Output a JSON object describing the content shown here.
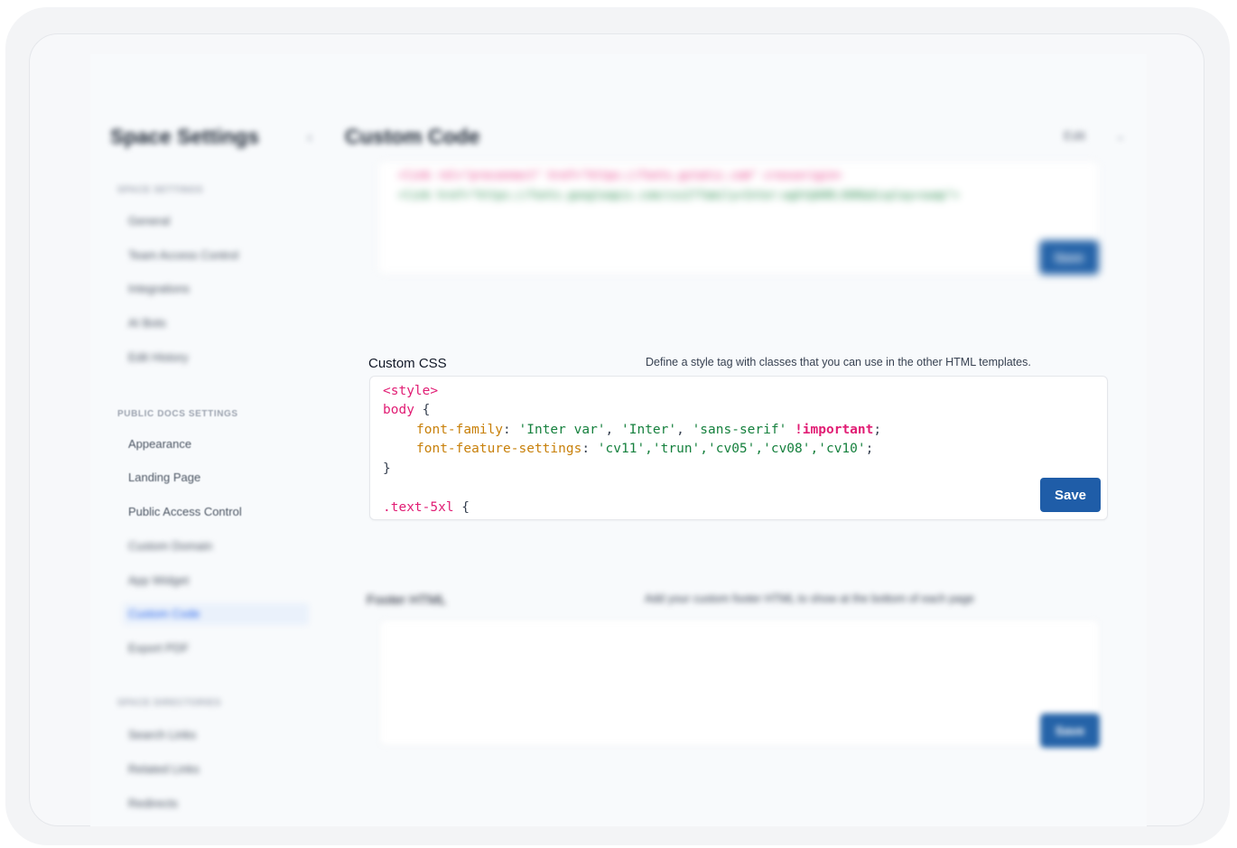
{
  "sidebar": {
    "title": "Space Settings",
    "groups": [
      {
        "label": "SPACE SETTINGS",
        "items": [
          "General",
          "Team Access Control",
          "Integrations",
          "AI Bots",
          "Edit History"
        ]
      },
      {
        "label": "PUBLIC DOCS SETTINGS",
        "items": [
          "Appearance",
          "Landing Page",
          "Public Access Control",
          "Custom Domain",
          "App Widget",
          "Custom Code",
          "Export PDF"
        ]
      },
      {
        "label": "SPACE DIRECTORIES",
        "items": [
          "Search Links",
          "Related Links",
          "Redirects"
        ]
      }
    ]
  },
  "header": {
    "title": "Custom Code",
    "right_label": "Edit"
  },
  "head_section": {
    "code_lines": [
      "<link rel=\"preconnect\" href=\"https://fonts.gstatic.com\" crossorigin>",
      "<link href=\"https://fonts.googleapis.com/css2?family=Inter:wght@400;600&display=swap\">"
    ],
    "save_label": "Save"
  },
  "css_section": {
    "label": "Custom CSS",
    "description": "Define a style tag with classes that you can use in the other HTML templates.",
    "code": {
      "l1_tag": "<style>",
      "l2_sel": "body",
      "l2_brace": " {",
      "l3_prop": "font-family",
      "l3_colon": ": ",
      "l3_v1": "'Inter var'",
      "l3_c1": ", ",
      "l3_v2": "'Inter'",
      "l3_c2": ", ",
      "l3_v3": "'sans-serif'",
      "l3_sp": " ",
      "l3_imp": "!important",
      "l3_end": ";",
      "l4_prop": "font-feature-settings",
      "l4_colon": ": ",
      "l4_vals": "'cv11','trun','cv05','cv08','cv10'",
      "l4_end": ";",
      "l5": "}",
      "l7_sel": ".text-5xl",
      "l7_brace": " {"
    },
    "save_label": "Save"
  },
  "footer_section": {
    "label": "Footer HTML",
    "description": "Add your custom footer HTML to show at the bottom of each page",
    "save_label": "Save"
  },
  "colors": {
    "accent": "#1f5da8",
    "tag": "#e11d74",
    "property": "#c8800a",
    "string": "#15803d"
  }
}
